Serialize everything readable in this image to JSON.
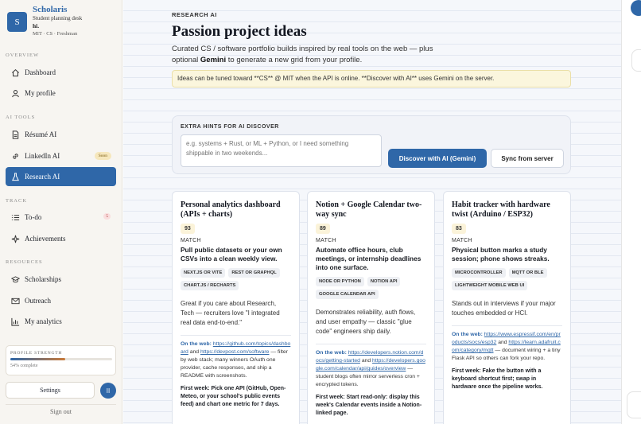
{
  "brand": {
    "logo_letter": "S",
    "name": "Scholaris",
    "tagline": "Student planning desk",
    "user": "hi.",
    "meta": "MIT · CS · Freshman"
  },
  "sidebar": {
    "sections": {
      "overview": "OVERVIEW",
      "ai_tools": "AI TOOLS",
      "track": "TRACK",
      "resources": "RESOURCES"
    },
    "items": [
      {
        "label": "Dashboard",
        "icon": "home-icon"
      },
      {
        "label": "My profile",
        "icon": "user-icon"
      },
      {
        "label": "Résumé AI",
        "icon": "document-icon"
      },
      {
        "label": "LinkedIn AI",
        "icon": "link-icon",
        "badge": "Soon"
      },
      {
        "label": "Research AI",
        "icon": "flask-icon",
        "active": true
      },
      {
        "label": "To-do",
        "icon": "list-icon",
        "badge": "5"
      },
      {
        "label": "Achievements",
        "icon": "sparkle-icon"
      },
      {
        "label": "Scholarships",
        "icon": "graduation-cap-icon"
      },
      {
        "label": "Outreach",
        "icon": "mail-icon"
      },
      {
        "label": "My analytics",
        "icon": "bar-chart-icon"
      }
    ],
    "profile_strength": {
      "label": "PROFILE STRENGTH",
      "value_text": "54% complete",
      "progress": 0.54
    },
    "settings_label": "Settings",
    "pause_label": "II",
    "signout_label": "Sign out"
  },
  "main": {
    "eyebrow": "RESEARCH AI",
    "title": "Passion project ideas",
    "subtitle_part1": "Curated CS / software portfolio builds inspired by real tools on the web — plus optional",
    "subtitle_bold": "Gemini",
    "subtitle_part2": "to generate a new grid from your profile.",
    "notice": "Ideas can be tuned toward **CS** @ MIT when the API is online. **Discover with AI** uses Gemini on the server.",
    "hints": {
      "label": "EXTRA HINTS FOR AI DISCOVER",
      "placeholder": "e.g. systems + Rust, or ML + Python, or I need something shippable in two weekends...",
      "discover_label": "Discover with AI (Gemini)",
      "sync_label": "Sync from server"
    },
    "cards": [
      {
        "title": "Personal analytics dashboard (APIs + charts)",
        "score": "93",
        "match_label": "MATCH",
        "summary": "Pull public datasets or your own CSVs into a clean weekly view.",
        "tags": [
          "NEXT.JS OR VITE",
          "REST OR GRAPHQL",
          "CHART.JS / RECHARTS"
        ],
        "why": "Great if you care about Research, Tech — recruiters love \"I integrated real data end-to-end.\"",
        "web_label": "On the web:",
        "link1": "https://github.com/topics/dashboard",
        "and": "and",
        "link2": "https://devpost.com/software",
        "web_rest": "— filter by web stack; many winners OAuth one provider, cache responses, and ship a README with screenshots.",
        "first_week": "First week: Pick one API (GitHub, Open-Meteo, or your school's public events feed) and chart one metric for 7 days."
      },
      {
        "title": "Notion + Google Calendar two-way sync",
        "score": "89",
        "match_label": "MATCH",
        "summary": "Automate office hours, club meetings, or internship deadlines into one surface.",
        "tags": [
          "NODE OR PYTHON",
          "NOTION API",
          "GOOGLE CALENDAR API"
        ],
        "why": "Demonstrates reliability, auth flows, and user empathy — classic \"glue code\" engineers ship daily.",
        "web_label": "On the web:",
        "link1": "https://developers.notion.com/docs/getting-started",
        "and": "and",
        "link2": "https://developers.google.com/calendar/api/guides/overview",
        "web_rest": "— student blogs often mirror serverless cron + encrypted tokens.",
        "first_week": "First week: Start read-only: display this week's Calendar events inside a Notion-linked page."
      },
      {
        "title": "Habit tracker with hardware twist (Arduino / ESP32)",
        "score": "83",
        "match_label": "MATCH",
        "summary": "Physical button marks a study session; phone shows streaks.",
        "tags": [
          "MICROCONTROLLER",
          "MQTT OR BLE",
          "LIGHTWEIGHT MOBILE WEB UI"
        ],
        "why": "Stands out in interviews if your major touches embedded or HCI.",
        "web_label": "On the web:",
        "link1": "https://www.espressif.com/en/products/socs/esp32",
        "and": "and",
        "link2": "https://learn.adafruit.com/category/mqtt",
        "web_rest": "— document wiring + a tiny Flask API so others can fork your repo.",
        "first_week": "First week: Fake the button with a keyboard shortcut first; swap in hardware once the pipeline works."
      }
    ]
  },
  "colors": {
    "accent": "#2f67a8",
    "notice_bg": "#fbf6dd",
    "score_bg": "#fbf3d9"
  }
}
